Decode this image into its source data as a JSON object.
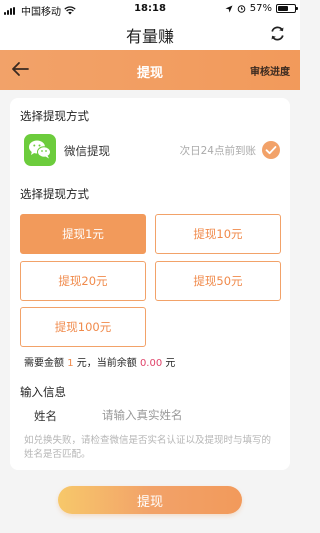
{
  "status_bar": {
    "carrier": "中国移动",
    "time": "18:18",
    "battery": "57%",
    "battery_level": 0.57
  },
  "app": {
    "title": "有量赚"
  },
  "nav": {
    "title": "提现",
    "audit_label": "审核进度"
  },
  "withdraw_method": {
    "section_title": "选择提现方式",
    "method_label": "微信提现",
    "arrival_note": "次日24点前到账"
  },
  "amount_section": {
    "section_title": "选择提现方式",
    "options": [
      "提现1元",
      "提现10元",
      "提现20元",
      "提现50元",
      "提现100元"
    ],
    "selected_index": 0
  },
  "balance": {
    "prefix": "需要金额",
    "required": "1",
    "middle": "元，当前余额",
    "current": "0.00",
    "suffix": "元"
  },
  "info": {
    "section_title": "输入信息",
    "name_label": "姓名",
    "name_placeholder": "请输入真实姓名",
    "hint": "如兑换失败，请检查微信是否实名认证以及提现时与填写的姓名是否匹配。"
  },
  "submit": {
    "label": "提现"
  },
  "colors": {
    "accent": "#f2a269",
    "wechat_green": "#6ccc3c",
    "balance_red": "#e0446a"
  }
}
